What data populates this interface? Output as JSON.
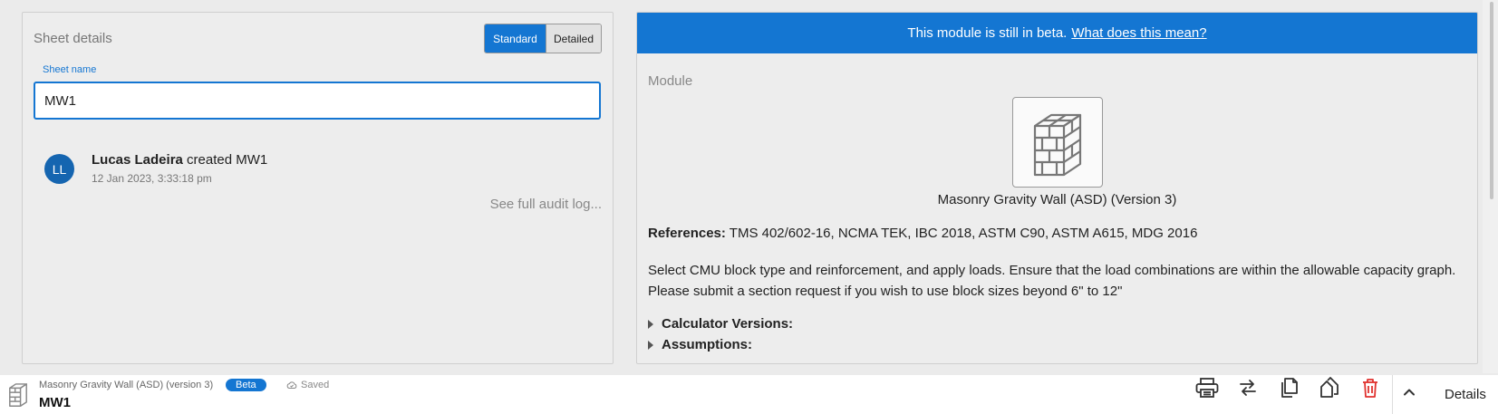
{
  "sheet_details": {
    "title": "Sheet details",
    "toggle": {
      "standard_label": "Standard",
      "detailed_label": "Detailed",
      "active": "Standard"
    },
    "sheet_name_label": "Sheet name",
    "sheet_name_value": "MW1",
    "audit": {
      "avatar_initials": "LL",
      "user": "Lucas Ladeira",
      "action": " created MW1",
      "timestamp": "12 Jan 2023, 3:33:18 pm",
      "full_log_link": "See full audit log..."
    }
  },
  "module_panel": {
    "beta_banner_text": "This module is still in beta.",
    "beta_banner_link": "What does this mean?",
    "module_heading": "Module",
    "module_icon": "brick-wall-icon",
    "module_name": "Masonry Gravity Wall (ASD) (Version 3)",
    "references_label": "References:",
    "references_value": " TMS 402/602-16, NCMA TEK, IBC 2018, ASTM C90, ASTM A615, MDG 2016",
    "description": "Select CMU block type and reinforcement, and apply loads. Ensure that the load combinations are within the allowable capacity graph. Please submit a section request if you wish to use block sizes beyond 6\" to 12\"",
    "calculator_versions_label": "Calculator Versions:",
    "assumptions_label": "Assumptions:"
  },
  "footer": {
    "module_name": "Masonry Gravity Wall (ASD) (version 3)",
    "beta_badge": "Beta",
    "saved_status": "Saved",
    "sheet_name": "MW1",
    "actions": [
      "print-icon",
      "swap-icon",
      "copy-icon",
      "duplicate-icon",
      "trash-icon"
    ],
    "details_label": "Details"
  },
  "colors": {
    "accent": "#1476d2",
    "danger": "#e0312e",
    "background": "#ebebeb"
  }
}
